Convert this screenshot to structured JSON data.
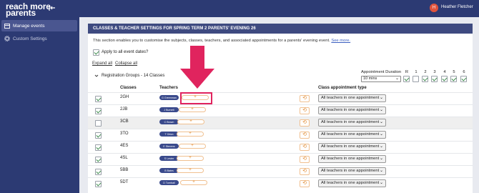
{
  "brand": {
    "line1": "reach more",
    "line2": "parents"
  },
  "sidebar": {
    "items": [
      {
        "label": "Manage events",
        "icon": "calendar-icon"
      },
      {
        "label": "Custom Settings",
        "icon": "gear-icon"
      }
    ]
  },
  "header": {
    "avatar_initial": "H",
    "user_name": "Heather Fletcher"
  },
  "panel": {
    "title": "CLASSES & TEACHER SETTINGS FOR SPRING TERM 2 PARENTS' EVENING 26",
    "description": "This section enables you to customise the subjects, classes, teachers, and associated appointments for a parents' evening event.",
    "see_more": "See more.",
    "apply_all_label": "Apply to all event dates?",
    "expand_all": "Expand all",
    "collapse_all": "Collapse all",
    "group_label": "Registration Groups - 14 Classes",
    "duration_label": "Appointment Duration",
    "duration_value": "10 mins",
    "year_columns": [
      "R",
      "1",
      "2",
      "3",
      "4",
      "5",
      "6"
    ],
    "columns": {
      "classes": "Classes",
      "teachers": "Teachers",
      "appt_type": "Class appointment type"
    },
    "add_symbol": "+",
    "history_symbol": "⟲",
    "rows": [
      {
        "class": "2GH",
        "teacher": "G Greenman",
        "checked": true,
        "appt": "All teachers in one appointment"
      },
      {
        "class": "2JB",
        "teacher": "J Burnett",
        "checked": true,
        "appt": "All teachers in one appointment"
      },
      {
        "class": "3CB",
        "teacher": "C Brown",
        "checked": false,
        "appt": "All teachers in one appointment"
      },
      {
        "class": "3TO",
        "teacher": "T Orton",
        "checked": true,
        "appt": "All teachers in one appointment"
      },
      {
        "class": "4ES",
        "teacher": "E Stevens",
        "checked": true,
        "appt": "All teachers in one appointment"
      },
      {
        "class": "4SL",
        "teacher": "S Lester",
        "checked": true,
        "appt": "All teachers in one appointment"
      },
      {
        "class": "5BB",
        "teacher": "B Bates",
        "checked": true,
        "appt": "All teachers in one appointment"
      },
      {
        "class": "5DT",
        "teacher": "D Turnball",
        "checked": true,
        "appt": "All teachers in one appointment"
      }
    ]
  },
  "colors": {
    "navy": "#2c3a73",
    "accent_orange": "#e08a30",
    "highlight_pink": "#e0245e"
  }
}
